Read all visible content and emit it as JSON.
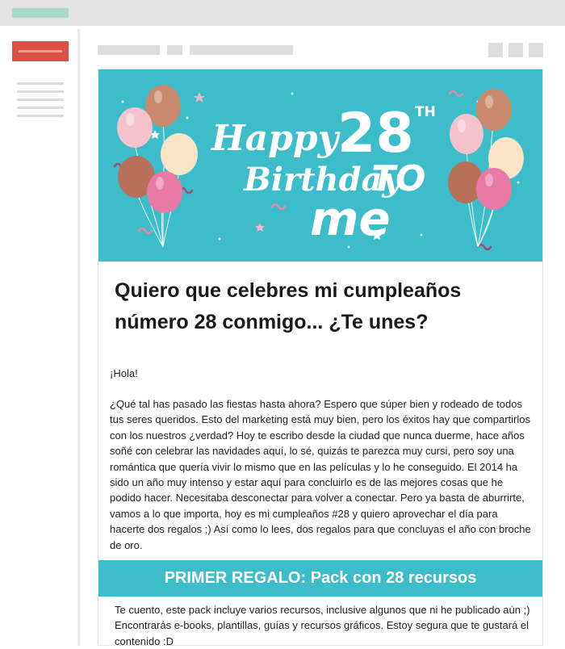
{
  "banner": {
    "line_happy": "Happy",
    "line_number": "28",
    "line_suffix": "TH",
    "line_birthday": "Birthday",
    "line_to": "TO",
    "line_me": "me",
    "colors": {
      "background": "#3dbcc9",
      "balloon_pink": "#e97aa5",
      "balloon_light_pink": "#f6c2cc",
      "balloon_brown": "#b8705b",
      "balloon_cream": "#fbe3c6",
      "balloon_copper": "#c98a6e"
    }
  },
  "email": {
    "headline": "Quiero que celebres mi cumpleaños número 28 conmigo... ¿Te unes?",
    "greeting": "¡Hola!",
    "body": "¿Qué tal has pasado las fiestas hasta ahora? Espero que súper bien y rodeado de todos tus seres queridos. Esto del marketing está muy bien, pero los éxitos hay que compartirlos con los nuestros ¿verdad? Hoy te escribo desde la ciudad que nunca duerme, hace años soñé con celebrar las navidades aquí, lo sé, quizás te parezca muy cursi, pero soy una romántica que quería vivir lo mismo que en las películas y lo he conseguido. El 2014 ha sido un año muy intenso y estar aquí para concluirlo es de las mejores cosas que he podido hacer. Necesitaba desconectar para volver a conectar. Pero ya basta de aburrirte, vamos a lo que importa, hoy es mi cumpleaños #28 y quiero aprovechar el día para hacerte dos regalos ;) Así como lo lees, dos regalos para que concluyas el año con broche de oro.",
    "section_title": "PRIMER REGALO: Pack con 28 recursos",
    "section_body": "Te cuento, este pack incluye varios recursos, inclusive algunos que ni he publicado aún ;) Encontrarás e-books, plantillas, guías y recursos gráficos. Estoy segura que te gustará el contenido :D"
  },
  "theme": {
    "accent_teal": "#3dbcc9",
    "compose_red": "#de4f45",
    "top_accent_green": "#a9dcc7"
  }
}
